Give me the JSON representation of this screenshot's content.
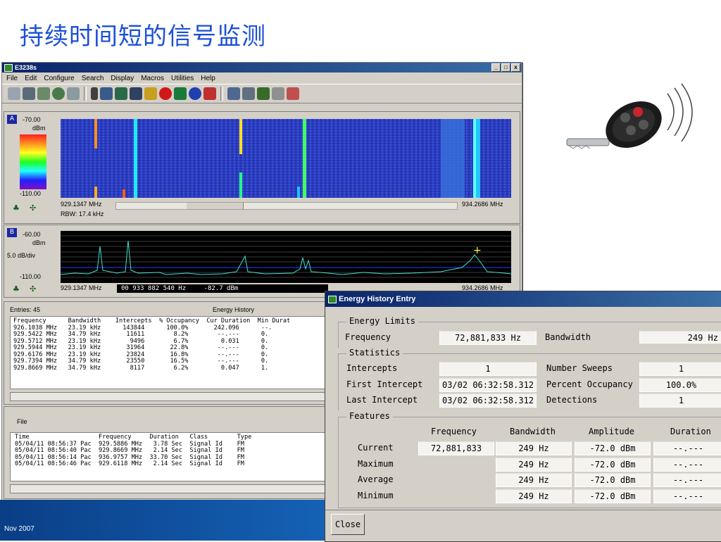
{
  "slide": {
    "title": "持续时间短的信号监测",
    "footer_date": "Nov 2007"
  },
  "app": {
    "title": "E3238s",
    "menu": [
      "File",
      "Edit",
      "Configure",
      "Search",
      "Display",
      "Macros",
      "Utilities",
      "Help"
    ]
  },
  "panel_a": {
    "badge": "A",
    "top_level": "-70.00",
    "unit": "dBm",
    "bottom_level": "-110.00",
    "start_freq": "929.1347 MHz",
    "stop_freq": "934.2686 MHz",
    "rbw": "RBW: 17.4 kHz"
  },
  "panel_b": {
    "badge": "B",
    "top_level": "-60.00",
    "unit": "dBm",
    "scale": "5.0 dB/div",
    "bottom_level": "-110.00",
    "start_freq": "929.1347 MHz",
    "stop_freq": "934.2686 MHz",
    "marker_freq": "00 933 882 540 Hz",
    "marker_amp": "-82.7 dBm"
  },
  "energy_panel": {
    "entries": "Entries: 45",
    "heading": "Energy History",
    "rows": [
      "Frequency      Bandwidth    Intercepts  % Occupancy  Cur Duration  Min Durat",
      "926.1038 MHz   23.19 kHz      143844      100.0%       242.096      --.",
      "929.5422 MHz   34.79 kHz       11611        8.2%        --.---      0.",
      "929.5712 MHz   23.19 kHz        9496        6.7%         0.031      0.",
      "929.5944 MHz   23.19 kHz       31964       22.8%        --.---      0.",
      "929.6176 MHz   23.19 kHz       23824       16.8%        --.---      0.",
      "929.7394 MHz   34.79 kHz       23550       16.5%        --.---      0.",
      "929.8669 MHz   34.79 kHz        8117        6.2%         0.047      1."
    ]
  },
  "file_panel": {
    "heading": "File",
    "rows": [
      "Time                   Frequency     Duration   Class        Type",
      "05/04/11 08:56:37 Pac  929.5886 MHz   3.78 Sec  Signal Id    FM",
      "05/04/11 08:56:40 Pac  929.8669 MHz   2.14 Sec  Signal Id    FM",
      "05/04/11 08:56:14 Pac  936.9757 MHz  33.70 Sec  Signal Id    FM",
      "05/04/11 08:56:46 Pac  929.6118 MHz   2.14 Sec  Signal Id    FM"
    ]
  },
  "dialog": {
    "title": "Energy History Entry",
    "limits": {
      "group": "Energy Limits",
      "freq_label": "Frequency",
      "freq_value": "72,881,833 Hz",
      "bw_label": "Bandwidth",
      "bw_value": "249  Hz"
    },
    "stats": {
      "group": "Statistics",
      "intercepts_label": "Intercepts",
      "intercepts_value": "1",
      "first_label": "First Intercept",
      "first_value": "03/02 06:32:58.312",
      "last_label": "Last Intercept",
      "last_value": "03/02 06:32:58.312",
      "sweeps_label": "Number Sweeps",
      "sweeps_value": "1",
      "occupancy_label": "Percent Occupancy",
      "occupancy_value": "100.0%",
      "detections_label": "Detections",
      "detections_value": "1"
    },
    "features": {
      "group": "Features",
      "headers": [
        "Frequency",
        "Bandwidth",
        "Amplitude",
        "Duration"
      ],
      "rows": [
        {
          "label": "Current",
          "freq": "72,881,833",
          "bw": "249  Hz",
          "amp": "-72.0 dBm",
          "dur": "--.---"
        },
        {
          "label": "Maximum",
          "freq": "",
          "bw": "249  Hz",
          "amp": "-72.0 dBm",
          "dur": "--.---"
        },
        {
          "label": "Average",
          "freq": "",
          "bw": "249  Hz",
          "amp": "-72.0 dBm",
          "dur": "--.---"
        },
        {
          "label": "Minimum",
          "freq": "",
          "bw": "249  Hz",
          "amp": "-72.0 dBm",
          "dur": "--.---"
        }
      ]
    },
    "close_label": "Close"
  }
}
